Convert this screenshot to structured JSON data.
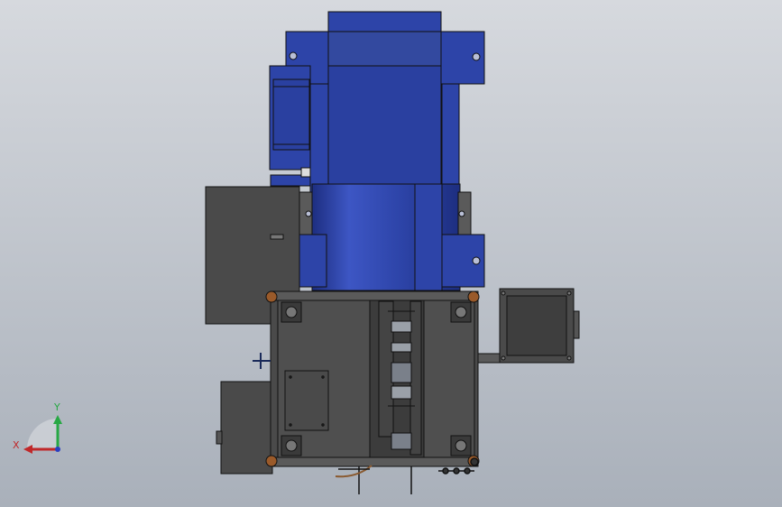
{
  "viewport": {
    "background_top": "#d6d9de",
    "background_bottom": "#a9b0ba"
  },
  "colors": {
    "blue_part": "#2d44a8",
    "blue_dark": "#1d2e80",
    "blue_light": "#3d56c4",
    "gray_part": "#4a4a4a",
    "gray_dark": "#2e2e2e",
    "gray_mid": "#5a5a5a",
    "edge": "#111111",
    "bolt_orange": "#9a5a2a",
    "axis_x": "#c0282a",
    "axis_y": "#27a844",
    "axis_z": "#2a3fc0"
  },
  "triad": {
    "x_label": "X",
    "y_label": "Y"
  },
  "icons": {
    "orientation_triad": "axis-triad-icon"
  }
}
